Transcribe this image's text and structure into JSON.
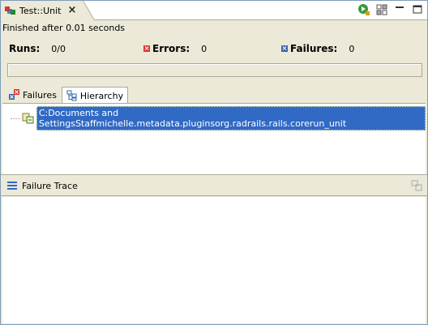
{
  "view": {
    "title": "Test::Unit",
    "close_glyph": "×"
  },
  "toolbar": {
    "icons": [
      "run-again-icon",
      "history-icon",
      "minimize-icon",
      "maximize-icon"
    ]
  },
  "status": "Finished after 0.01 seconds",
  "counters": {
    "runs_label": "Runs:",
    "runs_value": "0/0",
    "errors_label": "Errors:",
    "errors_value": "0",
    "failures_label": "Failures:",
    "failures_value": "0"
  },
  "progress": 0,
  "tabs": [
    {
      "label": "Failures",
      "active": false,
      "icon": "failures-icon"
    },
    {
      "label": "Hierarchy",
      "active": true,
      "icon": "hierarchy-icon"
    }
  ],
  "tree": {
    "root_label": "C:Documents and SettingsStaffmichelle.metadata.pluginsorg.radrails.rails.corerun_unit"
  },
  "trace": {
    "title": "Failure Trace"
  },
  "colors": {
    "selection": "#316ac5",
    "error": "#dd3333",
    "failure": "#3366aa"
  }
}
